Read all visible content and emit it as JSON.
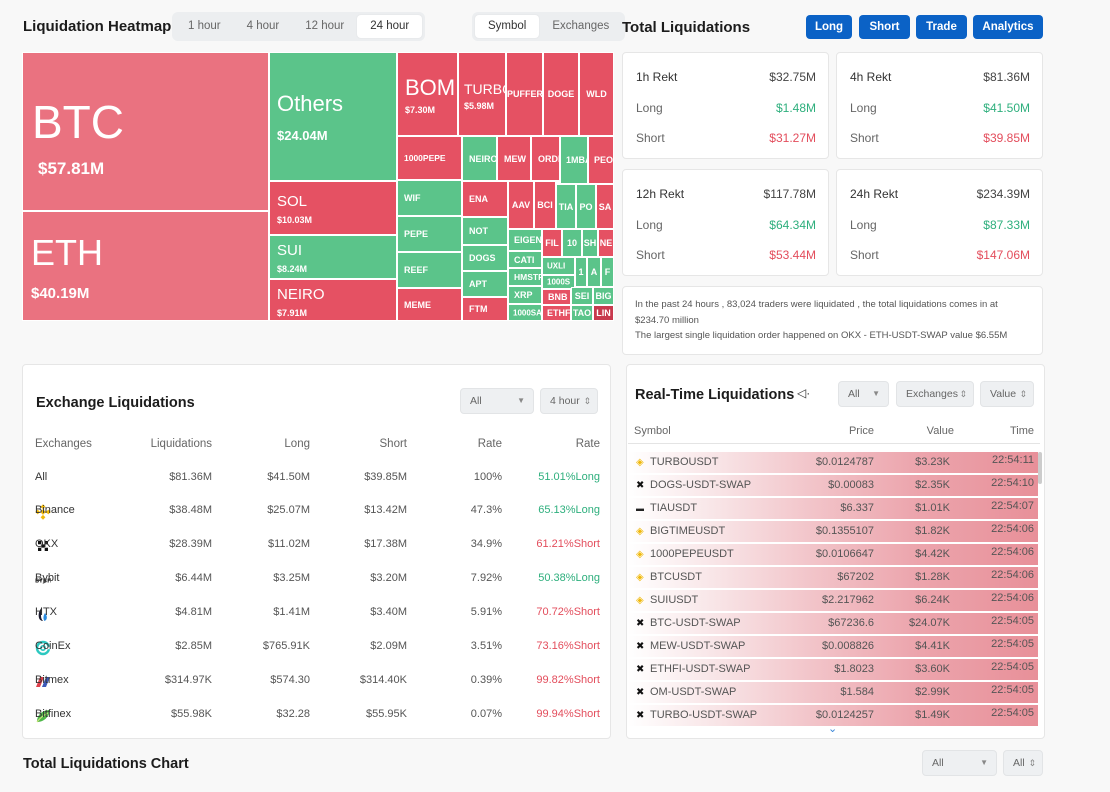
{
  "heatmap": {
    "title": "Liquidation Heatmap",
    "time_tabs": [
      {
        "label": "1 hour",
        "active": false
      },
      {
        "label": "4 hour",
        "active": false
      },
      {
        "label": "12 hour",
        "active": false
      },
      {
        "label": "24 hour",
        "active": true
      }
    ],
    "view_tabs": [
      {
        "label": "Symbol",
        "active": true
      },
      {
        "label": "Exchanges",
        "active": false
      }
    ],
    "colors": {
      "long_dominant": "#5bc48a",
      "short_dominant": "#e55163",
      "neutral_short": "#ea7280"
    },
    "cells": [
      {
        "symbol": "BTC",
        "value": "$57.81M",
        "color": "pink"
      },
      {
        "symbol": "ETH",
        "value": "$40.19M",
        "color": "pink"
      },
      {
        "symbol": "Others",
        "value": "$24.04M",
        "color": "green"
      },
      {
        "symbol": "SOL",
        "value": "$10.03M",
        "color": "red"
      },
      {
        "symbol": "SUI",
        "value": "$8.24M",
        "color": "green"
      },
      {
        "symbol": "NEIRO",
        "value": "$7.91M",
        "color": "red"
      },
      {
        "symbol": "BOMI",
        "value": "$7.30M",
        "color": "red"
      },
      {
        "symbol": "TURBO",
        "value": "$5.98M",
        "color": "red"
      },
      {
        "symbol": "PUFFER",
        "color": "red"
      },
      {
        "symbol": "DOGE",
        "color": "red"
      },
      {
        "symbol": "WLD",
        "color": "red"
      },
      {
        "symbol": "1000PEPE",
        "color": "red"
      },
      {
        "symbol": "NEIRO",
        "color": "green"
      },
      {
        "symbol": "MEW",
        "color": "red"
      },
      {
        "symbol": "ORDI",
        "color": "red"
      },
      {
        "symbol": "1MBA",
        "color": "green"
      },
      {
        "symbol": "PEOP",
        "color": "red"
      },
      {
        "symbol": "WIF",
        "color": "green"
      },
      {
        "symbol": "ENA",
        "color": "red"
      },
      {
        "symbol": "AAV",
        "color": "red"
      },
      {
        "symbol": "BCI",
        "color": "red"
      },
      {
        "symbol": "TIA",
        "color": "green"
      },
      {
        "symbol": "PO",
        "color": "green"
      },
      {
        "symbol": "SA",
        "color": "red"
      },
      {
        "symbol": "PEPE",
        "color": "green"
      },
      {
        "symbol": "NOT",
        "color": "green"
      },
      {
        "symbol": "EIGEN",
        "color": "green"
      },
      {
        "symbol": "FIL",
        "color": "red"
      },
      {
        "symbol": "10",
        "color": "green"
      },
      {
        "symbol": "SH",
        "color": "green"
      },
      {
        "symbol": "NE",
        "color": "red"
      },
      {
        "symbol": "REEF",
        "color": "green"
      },
      {
        "symbol": "DOGS",
        "color": "green"
      },
      {
        "symbol": "CATI",
        "color": "green"
      },
      {
        "symbol": "UXLI",
        "color": "green"
      },
      {
        "symbol": "1",
        "color": "green"
      },
      {
        "symbol": "A",
        "color": "green"
      },
      {
        "symbol": "F",
        "color": "green"
      },
      {
        "symbol": "HMSTR",
        "color": "green"
      },
      {
        "symbol": "1000S",
        "color": "green"
      },
      {
        "symbol": "APT",
        "color": "green"
      },
      {
        "symbol": "XRP",
        "color": "green"
      },
      {
        "symbol": "BNB",
        "color": "red"
      },
      {
        "symbol": "SEI",
        "color": "green"
      },
      {
        "symbol": "BIG",
        "color": "green"
      },
      {
        "symbol": "MEME",
        "color": "red"
      },
      {
        "symbol": "FTM",
        "color": "red"
      },
      {
        "symbol": "1000SA",
        "color": "green"
      },
      {
        "symbol": "ETHF",
        "color": "red"
      },
      {
        "symbol": "TAO",
        "color": "green"
      },
      {
        "symbol": "LIN",
        "color": "darkred"
      }
    ]
  },
  "total": {
    "title": "Total Liquidations",
    "buttons": [
      "Long",
      "Short",
      "Trade",
      "Analytics"
    ],
    "cards": [
      {
        "label": "1h Rekt",
        "total": "$32.75M",
        "long_label": "Long",
        "long": "$1.48M",
        "short_label": "Short",
        "short": "$31.27M"
      },
      {
        "label": "4h Rekt",
        "total": "$81.36M",
        "long_label": "Long",
        "long": "$41.50M",
        "short_label": "Short",
        "short": "$39.85M"
      },
      {
        "label": "12h Rekt",
        "total": "$117.78M",
        "long_label": "Long",
        "long": "$64.34M",
        "short_label": "Short",
        "short": "$53.44M"
      },
      {
        "label": "24h Rekt",
        "total": "$234.39M",
        "long_label": "Long",
        "long": "$87.33M",
        "short_label": "Short",
        "short": "$147.06M"
      }
    ],
    "summary_line1": "In the past 24 hours , 83,024 traders were liquidated , the total liquidations comes in at $234.70 million",
    "summary_line2": "The largest single liquidation order happened on OKX - ETH-USDT-SWAP value $6.55M"
  },
  "exchange": {
    "title": "Exchange Liquidations",
    "filter_select": "All",
    "period_select": "4 hour",
    "columns": [
      "Exchanges",
      "Liquidations",
      "Long",
      "Short",
      "Rate",
      "Rate"
    ],
    "rows": [
      {
        "name": "All",
        "icon": "",
        "liq": "$81.36M",
        "long": "$41.50M",
        "short": "$39.85M",
        "rate": "100%",
        "side_rate": "51.01%Long",
        "side": "long"
      },
      {
        "name": "Binance",
        "icon": "binance-icon",
        "liq": "$38.48M",
        "long": "$25.07M",
        "short": "$13.42M",
        "rate": "47.3%",
        "side_rate": "65.13%Long",
        "side": "long"
      },
      {
        "name": "OKX",
        "icon": "okx-icon",
        "liq": "$28.39M",
        "long": "$11.02M",
        "short": "$17.38M",
        "rate": "34.9%",
        "side_rate": "61.21%Short",
        "side": "short"
      },
      {
        "name": "Bybit",
        "icon": "bybit-icon",
        "liq": "$6.44M",
        "long": "$3.25M",
        "short": "$3.20M",
        "rate": "7.92%",
        "side_rate": "50.38%Long",
        "side": "long"
      },
      {
        "name": "HTX",
        "icon": "htx-icon",
        "liq": "$4.81M",
        "long": "$1.41M",
        "short": "$3.40M",
        "rate": "5.91%",
        "side_rate": "70.72%Short",
        "side": "short"
      },
      {
        "name": "CoinEx",
        "icon": "coinex-icon",
        "liq": "$2.85M",
        "long": "$765.91K",
        "short": "$2.09M",
        "rate": "3.51%",
        "side_rate": "73.16%Short",
        "side": "short"
      },
      {
        "name": "Bitmex",
        "icon": "bitmex-icon",
        "liq": "$314.97K",
        "long": "$574.30",
        "short": "$314.40K",
        "rate": "0.39%",
        "side_rate": "99.82%Short",
        "side": "short"
      },
      {
        "name": "Bitfinex",
        "icon": "bitfinex-icon",
        "liq": "$55.98K",
        "long": "$32.28",
        "short": "$55.95K",
        "rate": "0.07%",
        "side_rate": "99.94%Short",
        "side": "short"
      }
    ]
  },
  "realtime": {
    "title": "Real-Time Liquidations",
    "side_select": "All",
    "exchange_select": "Exchanges",
    "value_select": "Value",
    "columns": [
      "Symbol",
      "Price",
      "Value",
      "Time"
    ],
    "rows": [
      {
        "exchange": "binance",
        "symbol": "TURBOUSDT",
        "price": "$0.0124787",
        "value": "$3.23K",
        "time": "22:54:11"
      },
      {
        "exchange": "okx",
        "symbol": "DOGS-USDT-SWAP",
        "price": "$0.00083",
        "value": "$2.35K",
        "time": "22:54:10"
      },
      {
        "exchange": "bybit",
        "symbol": "TIAUSDT",
        "price": "$6.337",
        "value": "$1.01K",
        "time": "22:54:07"
      },
      {
        "exchange": "binance",
        "symbol": "BIGTIMEUSDT",
        "price": "$0.1355107",
        "value": "$1.82K",
        "time": "22:54:06"
      },
      {
        "exchange": "binance",
        "symbol": "1000PEPEUSDT",
        "price": "$0.0106647",
        "value": "$4.42K",
        "time": "22:54:06"
      },
      {
        "exchange": "binance",
        "symbol": "BTCUSDT",
        "price": "$67202",
        "value": "$1.28K",
        "time": "22:54:06"
      },
      {
        "exchange": "binance",
        "symbol": "SUIUSDT",
        "price": "$2.217962",
        "value": "$6.24K",
        "time": "22:54:06"
      },
      {
        "exchange": "okx",
        "symbol": "BTC-USDT-SWAP",
        "price": "$67236.6",
        "value": "$24.07K",
        "time": "22:54:05"
      },
      {
        "exchange": "okx",
        "symbol": "MEW-USDT-SWAP",
        "price": "$0.008826",
        "value": "$4.41K",
        "time": "22:54:05"
      },
      {
        "exchange": "okx",
        "symbol": "ETHFI-USDT-SWAP",
        "price": "$1.8023",
        "value": "$3.60K",
        "time": "22:54:05"
      },
      {
        "exchange": "okx",
        "symbol": "OM-USDT-SWAP",
        "price": "$1.584",
        "value": "$2.99K",
        "time": "22:54:05"
      },
      {
        "exchange": "okx",
        "symbol": "TURBO-USDT-SWAP",
        "price": "$0.0124257",
        "value": "$1.49K",
        "time": "22:54:05"
      }
    ]
  },
  "chart_section": {
    "title": "Total Liquidations Chart",
    "filter_select": "All",
    "second_select": "All"
  },
  "colors": {
    "accent": "#0b62c6",
    "long": "#2eaf7d",
    "short": "#e34d5c"
  }
}
